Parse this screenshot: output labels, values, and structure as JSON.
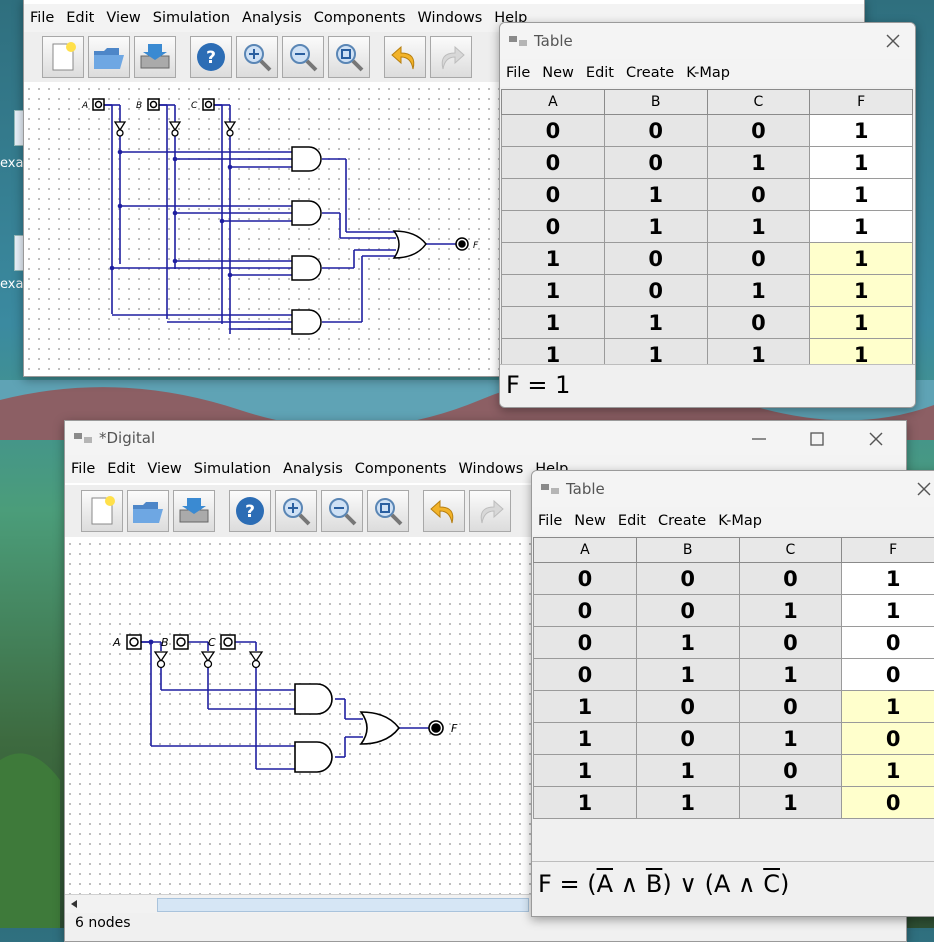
{
  "desktop": {
    "icon_label_1": "exa",
    "icon_label_2": "exa"
  },
  "win1": {
    "menu": [
      "File",
      "Edit",
      "View",
      "Simulation",
      "Analysis",
      "Components",
      "Windows",
      "Help"
    ],
    "inputs": [
      "A",
      "B",
      "C"
    ],
    "output": "F"
  },
  "table1": {
    "title": "Table",
    "menu": [
      "File",
      "New",
      "Edit",
      "Create",
      "K-Map"
    ],
    "headers": [
      "A",
      "B",
      "C",
      "F"
    ],
    "rows": [
      [
        "0",
        "0",
        "0",
        "1"
      ],
      [
        "0",
        "0",
        "1",
        "1"
      ],
      [
        "0",
        "1",
        "0",
        "1"
      ],
      [
        "0",
        "1",
        "1",
        "1"
      ],
      [
        "1",
        "0",
        "0",
        "1"
      ],
      [
        "1",
        "0",
        "1",
        "1"
      ],
      [
        "1",
        "1",
        "0",
        "1"
      ],
      [
        "1",
        "1",
        "1",
        "1"
      ]
    ],
    "expression": "F = 1"
  },
  "win2": {
    "title": "*Digital",
    "menu": [
      "File",
      "Edit",
      "View",
      "Simulation",
      "Analysis",
      "Components",
      "Windows",
      "Help"
    ],
    "inputs": [
      "A",
      "B",
      "C"
    ],
    "output": "F",
    "status": "6 nodes"
  },
  "table2": {
    "title": "Table",
    "menu": [
      "File",
      "New",
      "Edit",
      "Create",
      "K-Map"
    ],
    "headers": [
      "A",
      "B",
      "C",
      "F"
    ],
    "rows": [
      [
        "0",
        "0",
        "0",
        "1"
      ],
      [
        "0",
        "0",
        "1",
        "1"
      ],
      [
        "0",
        "1",
        "0",
        "0"
      ],
      [
        "0",
        "1",
        "1",
        "0"
      ],
      [
        "1",
        "0",
        "0",
        "1"
      ],
      [
        "1",
        "0",
        "1",
        "0"
      ],
      [
        "1",
        "1",
        "0",
        "1"
      ],
      [
        "1",
        "1",
        "1",
        "0"
      ]
    ],
    "expression": {
      "f": "F",
      "eq": "=",
      "lp1": "(",
      "a": "A",
      "and1": "∧",
      "b": "B",
      "rp1": ")",
      "or": "∨",
      "lp2": "(",
      "a2": "A",
      "and2": "∧",
      "c": "C",
      "rp2": ")"
    }
  }
}
